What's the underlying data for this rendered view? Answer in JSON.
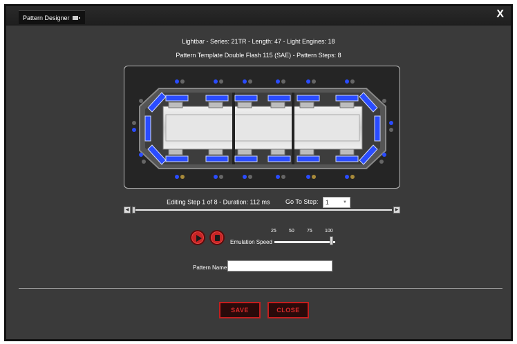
{
  "window": {
    "title": "Pattern Designer",
    "close_glyph": "X"
  },
  "info": {
    "line1": "Lightbar - Series: 21TR - Length: 47 - Light Engines: 18",
    "line2": "Pattern  Template Double Flash 115 (SAE) - Pattern Steps: 8"
  },
  "step": {
    "editing_text": "Editing Step 1 of 8 - Duration: 112 ms",
    "goto_label": "Go To Step:",
    "selected": "1"
  },
  "emulation": {
    "label": "Emulation Speed",
    "ticks": [
      "25",
      "50",
      "75",
      "100"
    ],
    "level": 100
  },
  "pattern_name": {
    "label": "Pattern Name:",
    "value": ""
  },
  "buttons": {
    "save": "SAVE",
    "close": "CLOSE"
  },
  "colors": {
    "accent_red": "#c41e1e",
    "light_blue": "#2a4cff",
    "background": "#3a3a3a"
  }
}
